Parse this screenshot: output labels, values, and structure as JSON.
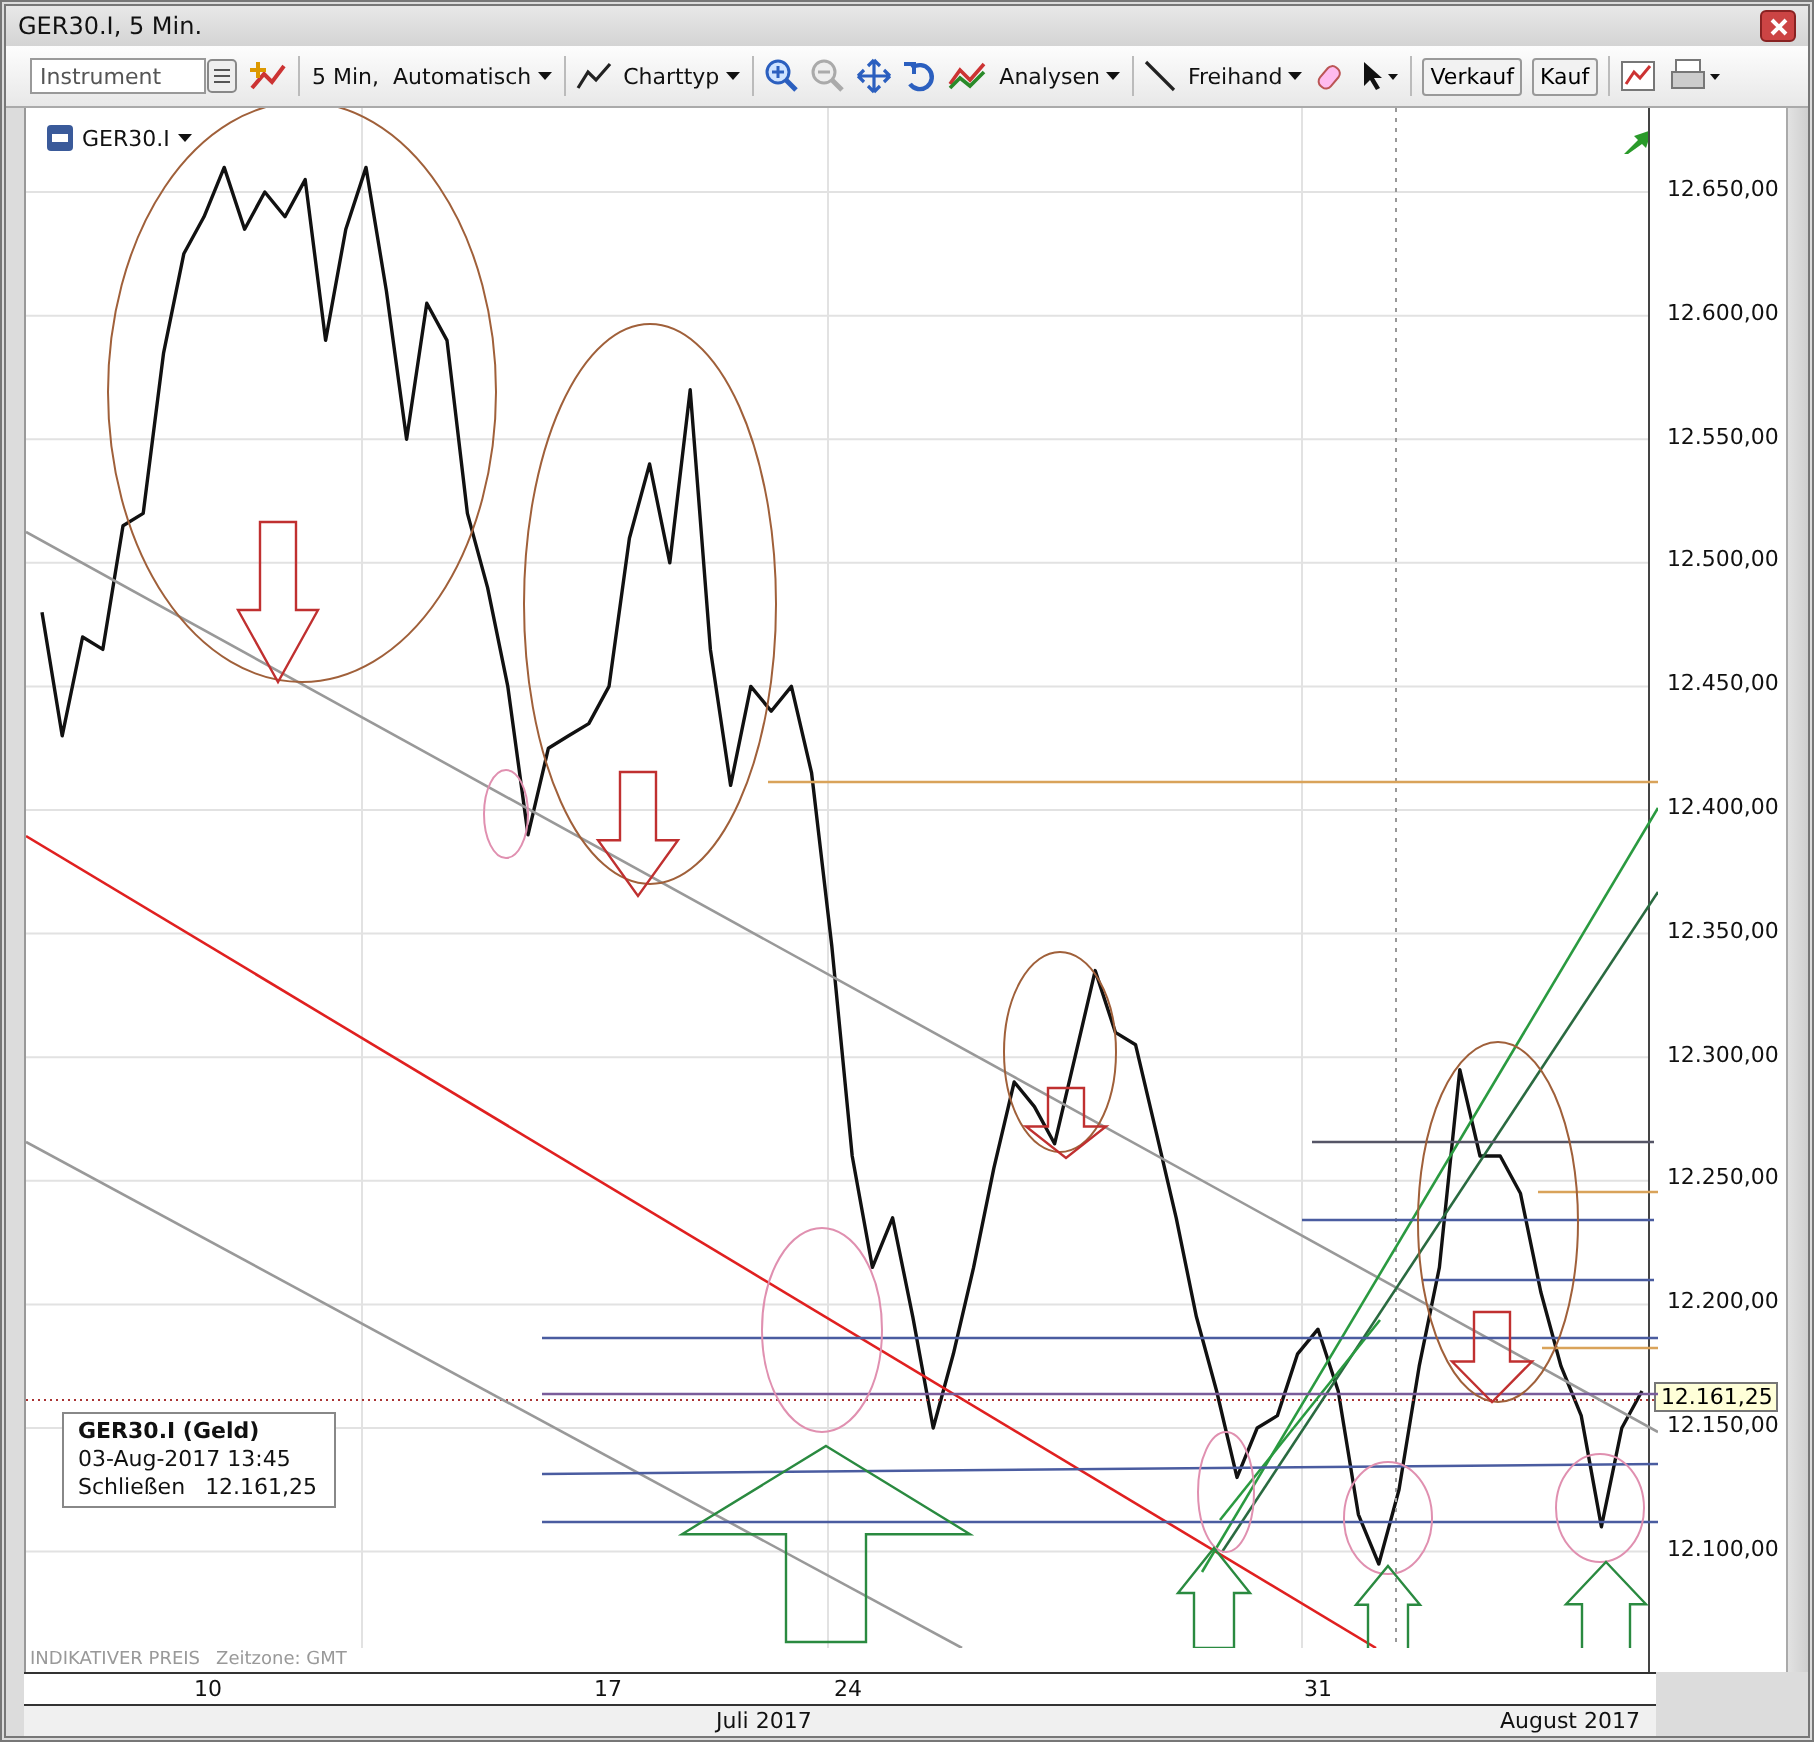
{
  "window": {
    "title": "GER30.I, 5 Min."
  },
  "toolbar": {
    "instrument_placeholder": "Instrument",
    "interval": "5 Min,  Automatisch",
    "chart_type": "Charttyp",
    "analyses": "Analysen",
    "drawing": "Freihand",
    "buttons": [
      "Verkauf",
      "Kauf"
    ]
  },
  "chart": {
    "info": {
      "title": "GER30.I (Geld)",
      "datetime": "03-Aug-2017 13:45",
      "close_label": "Schließen",
      "close_value": "12.161,25"
    },
    "footer": {
      "price_note": "INDIKATIVER PREIS",
      "timezone": "Zeitzone: GMT"
    },
    "current_price": "12.161,25",
    "x_days": [
      "10",
      "17",
      "24",
      "31"
    ],
    "x_months": [
      "Juli 2017",
      "August 2017"
    ],
    "chart_data": {
      "type": "line",
      "grid": true,
      "ylim": [
        12061,
        12684
      ],
      "categories": [
        null,
        null,
        null,
        null,
        null,
        null,
        null,
        null,
        null,
        null,
        null,
        null,
        null,
        null,
        null,
        null,
        null,
        null,
        null,
        null,
        null,
        null,
        null,
        null,
        null,
        null,
        null,
        null,
        null,
        null,
        null,
        null,
        null,
        null,
        null,
        null,
        null,
        null,
        null,
        null,
        null,
        null,
        null,
        null,
        null,
        null,
        null,
        null,
        null,
        null,
        null,
        null,
        null,
        null,
        null,
        null,
        null,
        null,
        null,
        null,
        null,
        null,
        null,
        null,
        null,
        null,
        null,
        null,
        null,
        null,
        null,
        null,
        null,
        null,
        null,
        null,
        null,
        null,
        null,
        null
      ],
      "series": [
        {
          "name": "GER30.I",
          "color": "#111111",
          "values": [
            12480,
            12430,
            12470,
            12465,
            12515,
            12520,
            12585,
            12625,
            12640,
            12660,
            12635,
            12650,
            12640,
            12655,
            12590,
            12635,
            12660,
            12610,
            12550,
            12605,
            12590,
            12520,
            12490,
            12450,
            12390,
            12425,
            12430,
            12435,
            12450,
            12510,
            12540,
            12500,
            12570,
            12465,
            12410,
            12450,
            12440,
            12450,
            12415,
            12345,
            12260,
            12215,
            12235,
            12195,
            12150,
            12180,
            12215,
            12255,
            12290,
            12280,
            12265,
            12300,
            12335,
            12310,
            12305,
            12270,
            12235,
            12195,
            12165,
            12130,
            12150,
            12155,
            12180,
            12190,
            12165,
            12115,
            12095,
            12125,
            12175,
            12215,
            12295,
            12260,
            12260,
            12245,
            12205,
            12175,
            12155,
            12110,
            12150,
            12165
          ]
        }
      ],
      "yticks": [
        {
          "value": 12650,
          "label": "12.650,00"
        },
        {
          "value": 12600,
          "label": "12.600,00"
        },
        {
          "value": 12550,
          "label": "12.550,00"
        },
        {
          "value": 12500,
          "label": "12.500,00"
        },
        {
          "value": 12450,
          "label": "12.450,00"
        },
        {
          "value": 12400,
          "label": "12.400,00"
        },
        {
          "value": 12350,
          "label": "12.350,00"
        },
        {
          "value": 12300,
          "label": "12.300,00"
        },
        {
          "value": 12250,
          "label": "12.250,00"
        },
        {
          "value": 12200,
          "label": "12.200,00"
        },
        {
          "value": 12150,
          "label": "12.150,00"
        },
        {
          "value": 12100,
          "label": "12.100,00"
        }
      ]
    }
  }
}
